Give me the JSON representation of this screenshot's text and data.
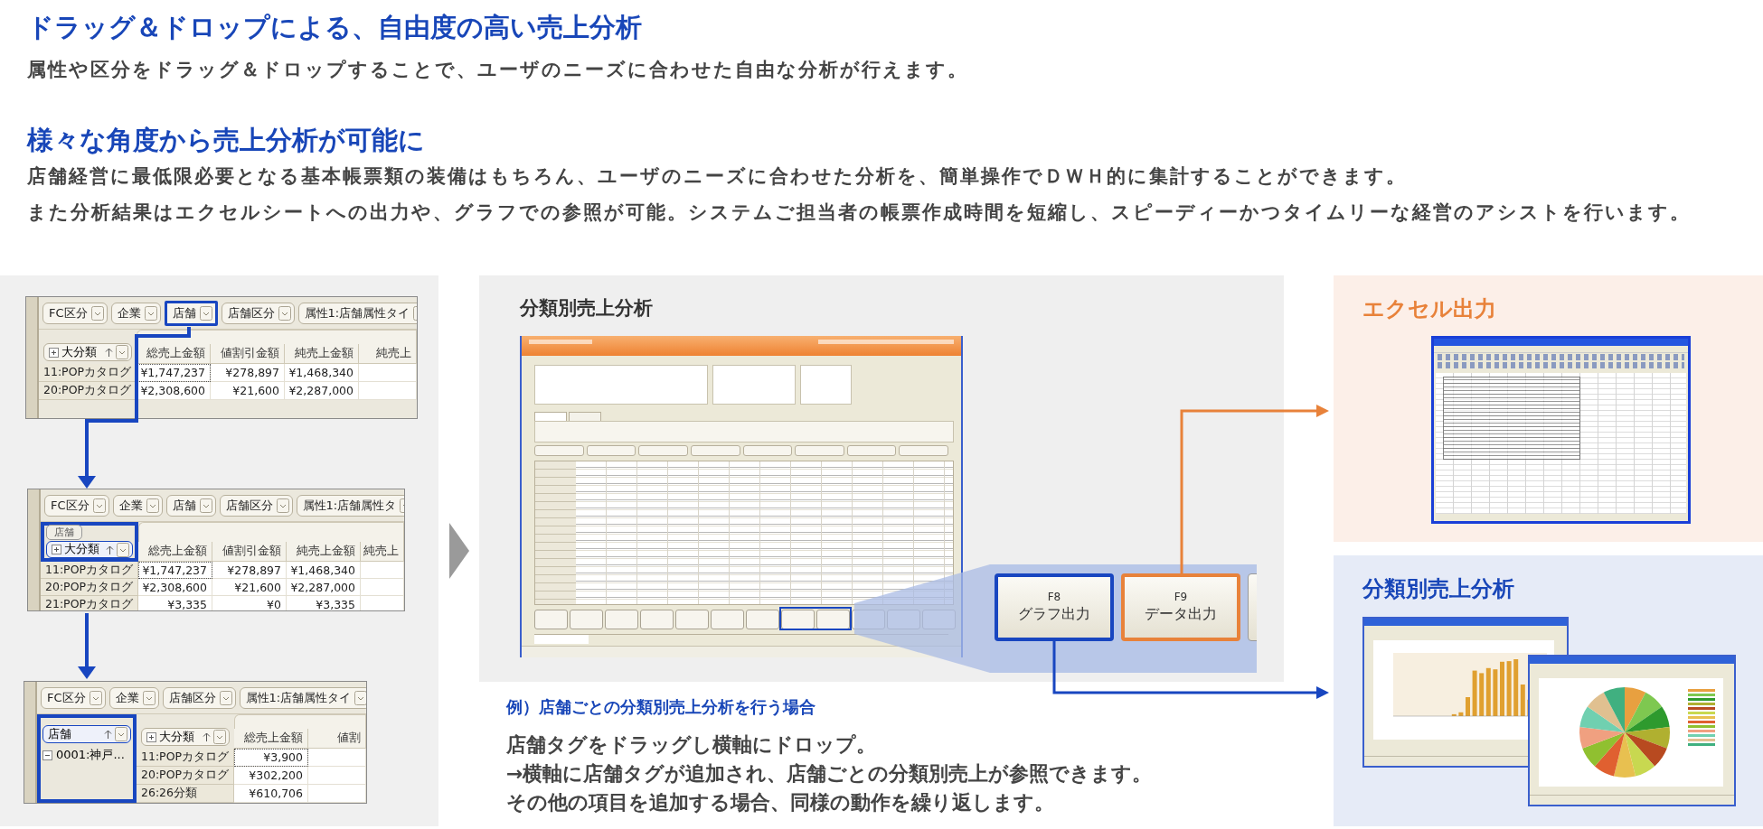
{
  "intro": [
    {
      "heading": "ドラッグ＆ドロップによる、自由度の高い売上分析",
      "paragraphs": [
        "属性や区分をドラッグ＆ドロップすることで、ユーザのニーズに合わせた自由な分析が行えます。"
      ]
    },
    {
      "heading": "様々な角度から売上分析が可能に",
      "paragraphs": [
        "店舗経営に最低限必要となる基本帳票類の装備はもちろん、ユーザのニーズに合わせた分析を、簡単操作でＤＷＨ的に集計することができます。",
        "また分析結果はエクセルシートへの出力や、グラフでの参照が可能。システムご担当者の帳票作成時間を短縮し、スピーディーかつタイムリーな経営のアシストを行います。"
      ]
    }
  ],
  "pivot_examples": [
    {
      "column_tags": [
        {
          "label": "FC区分",
          "highlighted": false
        },
        {
          "label": "企業",
          "highlighted": false
        },
        {
          "label": "店舗",
          "highlighted": true
        },
        {
          "label": "店舗区分",
          "highlighted": false
        },
        {
          "label": "属性1:店舗属性タイ",
          "highlighted": false
        }
      ],
      "row_tags": [
        {
          "label": "大分類",
          "expandable": true,
          "highlighted": false
        }
      ],
      "columns": [
        "総売上金額",
        "値割引金額",
        "純売上金額",
        "純売上"
      ],
      "rows": [
        {
          "label": "11:POPカタログ",
          "values": [
            "¥1,747,237",
            "¥278,897",
            "¥1,468,340"
          ]
        },
        {
          "label": "20:POPカタログ",
          "values": [
            "¥2,308,600",
            "¥21,600",
            "¥2,287,000"
          ]
        }
      ]
    },
    {
      "column_tags": [
        {
          "label": "FC区分",
          "highlighted": false
        },
        {
          "label": "企業",
          "highlighted": false
        },
        {
          "label": "店舗",
          "highlighted": false
        },
        {
          "label": "店舗区分",
          "highlighted": false
        },
        {
          "label": "属性1:店舗属性タ",
          "highlighted": false
        }
      ],
      "dragged_tag": "店舗",
      "row_tags": [
        {
          "label": "大分類",
          "expandable": true,
          "highlighted": true
        }
      ],
      "columns": [
        "総売上金額",
        "値割引金額",
        "純売上金額",
        "純売上"
      ],
      "rows": [
        {
          "label": "11:POPカタログ",
          "values": [
            "¥1,747,237",
            "¥278,897",
            "¥1,468,340"
          ]
        },
        {
          "label": "20:POPカタログ",
          "values": [
            "¥2,308,600",
            "¥21,600",
            "¥2,287,000"
          ]
        },
        {
          "label": "21:POPカタログ",
          "values": [
            "¥3,335",
            "¥0",
            "¥3,335"
          ]
        }
      ]
    },
    {
      "column_tags": [
        {
          "label": "FC区分",
          "highlighted": false
        },
        {
          "label": "企業",
          "highlighted": false
        },
        {
          "label": "店舗区分",
          "highlighted": false
        },
        {
          "label": "属性1:店舗属性タイ",
          "highlighted": false
        }
      ],
      "row_tags": [
        {
          "label": "店舗",
          "expandable": false,
          "highlighted": true
        },
        {
          "label": "大分類",
          "expandable": true,
          "highlighted": false
        }
      ],
      "outer_rows": [
        {
          "label": "0001:神戸...",
          "expanded": true
        }
      ],
      "columns": [
        "総売上金額",
        "値割"
      ],
      "rows": [
        {
          "label": "11:POPカタログ",
          "values": [
            "¥3,900"
          ]
        },
        {
          "label": "20:POPカタログ",
          "values": [
            "¥302,200"
          ]
        },
        {
          "label": "26:26分類",
          "values": [
            "¥610,706"
          ]
        }
      ]
    }
  ],
  "analysis_example": {
    "heading": "分類別売上分析",
    "function_keys": [
      {
        "key": "F8",
        "label": "グラフ出力",
        "color": "#1846c0"
      },
      {
        "key": "F9",
        "label": "データ出力",
        "color": "#e8823a"
      }
    ],
    "example_label": "例）店舗ごとの分類別売上分析を行う場合",
    "description": [
      "店舗タグをドラッグし横軸にドロップ。",
      "→横軸に店舗タグが追加され、店舗ごとの分類別売上が参照できます。",
      "その他の項目を追加する場合、同様の動作を繰り返します。"
    ]
  },
  "excel_output": {
    "title": "エクセル出力"
  },
  "graph_output": {
    "title": "分類別売上分析"
  }
}
